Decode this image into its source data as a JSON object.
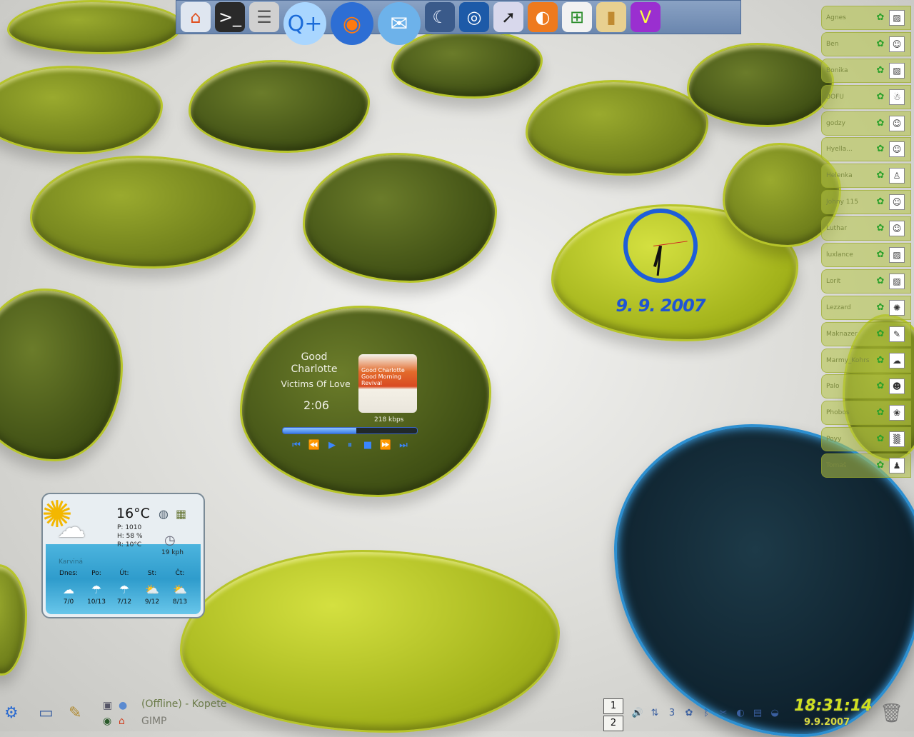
{
  "launcher": {
    "items": [
      {
        "name": "home-icon",
        "glyph": "⌂",
        "color": "#e05020",
        "bg": "#dfe6f0"
      },
      {
        "name": "terminal-icon",
        "glyph": ">_",
        "color": "#fff",
        "bg": "#2a2a2a"
      },
      {
        "name": "database-icon",
        "glyph": "☰",
        "color": "#555",
        "bg": "#d0d0d0"
      },
      {
        "name": "search-plus-icon",
        "glyph": "Q+",
        "color": "#1b6bd8",
        "bg": "#a9d6ff"
      },
      {
        "name": "firefox-icon",
        "glyph": "◉",
        "color": "#ff7a10",
        "bg": "#2d6ed4"
      },
      {
        "name": "mail-globe-icon",
        "glyph": "✉",
        "color": "#ffffff",
        "bg": "#6db2ea"
      },
      {
        "name": "wolf-icon",
        "glyph": "☾",
        "color": "#e8f0ff",
        "bg": "#3a5a8a"
      },
      {
        "name": "eye-icon",
        "glyph": "◎",
        "color": "#fff",
        "bg": "#1d5aa8"
      },
      {
        "name": "cursor-screen-icon",
        "glyph": "➚",
        "color": "#222",
        "bg": "#d8d8ec"
      },
      {
        "name": "media-disc-icon",
        "glyph": "◐",
        "color": "#fff",
        "bg": "#ee7a1e"
      },
      {
        "name": "windows-icon",
        "glyph": "⊞",
        "color": "#2e8f2e",
        "bg": "#f2f2f2"
      },
      {
        "name": "door-icon",
        "glyph": "▮",
        "color": "#c08a30",
        "bg": "#e8d090"
      },
      {
        "name": "v-icon",
        "glyph": "V",
        "color": "#ffff40",
        "bg": "#9a2fd0"
      }
    ]
  },
  "contacts": [
    {
      "name": "Agnes",
      "status": "✿",
      "avatar": "▨"
    },
    {
      "name": "Ben",
      "status": "✿",
      "avatar": "☺"
    },
    {
      "name": "Bonika",
      "status": "✿",
      "avatar": "▨"
    },
    {
      "name": "BOFU",
      "status": "✿",
      "avatar": "☃"
    },
    {
      "name": "godzy",
      "status": "✿",
      "avatar": "☺"
    },
    {
      "name": "Hyella...",
      "status": "✿",
      "avatar": "☺"
    },
    {
      "name": "Helenka",
      "status": "✿",
      "avatar": "♙"
    },
    {
      "name": "Johny 115",
      "status": "✿",
      "avatar": "☺"
    },
    {
      "name": "Luthar",
      "status": "✿",
      "avatar": "☺"
    },
    {
      "name": "luxlance",
      "status": "✿",
      "avatar": "▨"
    },
    {
      "name": "Lorit",
      "status": "✿",
      "avatar": "▨"
    },
    {
      "name": "Lezzard",
      "status": "✿",
      "avatar": "✺"
    },
    {
      "name": "Maknazer",
      "status": "✿",
      "avatar": "✎"
    },
    {
      "name": "Marmy_Kohrs",
      "status": "✿",
      "avatar": "☁"
    },
    {
      "name": "Palo",
      "status": "✿",
      "avatar": "☻"
    },
    {
      "name": "Phobos",
      "status": "✿",
      "avatar": "❀"
    },
    {
      "name": "Poyy",
      "status": "✿",
      "avatar": "▒"
    },
    {
      "name": "Tomaš",
      "status": "✿",
      "avatar": "♟"
    }
  ],
  "clock": {
    "date": "9. 9. 2007",
    "hour": 6,
    "minute": 31
  },
  "player": {
    "artist_line1": "Good",
    "artist_line2": "Charlotte",
    "title": "Victims Of Love",
    "time": "2:06",
    "bitrate": "218 kbps",
    "album_text": "Good Charlotte Good Morning Revival",
    "progress": 0.55,
    "controls": [
      {
        "name": "skip-back-icon",
        "glyph": "⏮"
      },
      {
        "name": "rewind-icon",
        "glyph": "⏪"
      },
      {
        "name": "play-icon",
        "glyph": "▶"
      },
      {
        "name": "pause-icon",
        "glyph": "⏸"
      },
      {
        "name": "stop-icon",
        "glyph": "■"
      },
      {
        "name": "fast-forward-icon",
        "glyph": "⏩"
      },
      {
        "name": "skip-forward-icon",
        "glyph": "⏭"
      }
    ]
  },
  "weather": {
    "temp": "16°C",
    "pressure": "P:  1010",
    "humidity": "H:  58 %",
    "realfeel": "R:  10°C",
    "wind": "19 kph",
    "city": "Karviná",
    "days": [
      {
        "label": "Dnes:",
        "icon": "☁",
        "range": "7/0"
      },
      {
        "label": "Po:",
        "icon": "☂",
        "range": "10/13"
      },
      {
        "label": "Út:",
        "icon": "☂",
        "range": "7/12"
      },
      {
        "label": "St:",
        "icon": "⛅",
        "range": "9/12"
      },
      {
        "label": "Čt:",
        "icon": "⛅",
        "range": "8/13"
      }
    ]
  },
  "taskbar": {
    "kopete": "(Offline) - Kopete",
    "gimp": "GIMP",
    "pager": [
      "1",
      "2"
    ],
    "tray": [
      {
        "name": "volume-icon",
        "glyph": "🔊"
      },
      {
        "name": "network-icon",
        "glyph": "⇅"
      },
      {
        "name": "badge-3-icon",
        "glyph": "3"
      },
      {
        "name": "kopete-icon",
        "glyph": "✿"
      },
      {
        "name": "bluetooth-icon",
        "glyph": "ᛒ"
      },
      {
        "name": "klipper-icon",
        "glyph": "✂"
      },
      {
        "name": "steam-icon",
        "glyph": "◐"
      },
      {
        "name": "folder-icon",
        "glyph": "▤"
      },
      {
        "name": "disk-icon",
        "glyph": "◒"
      }
    ],
    "time": "18:31:14",
    "date": "9.9.2007"
  }
}
